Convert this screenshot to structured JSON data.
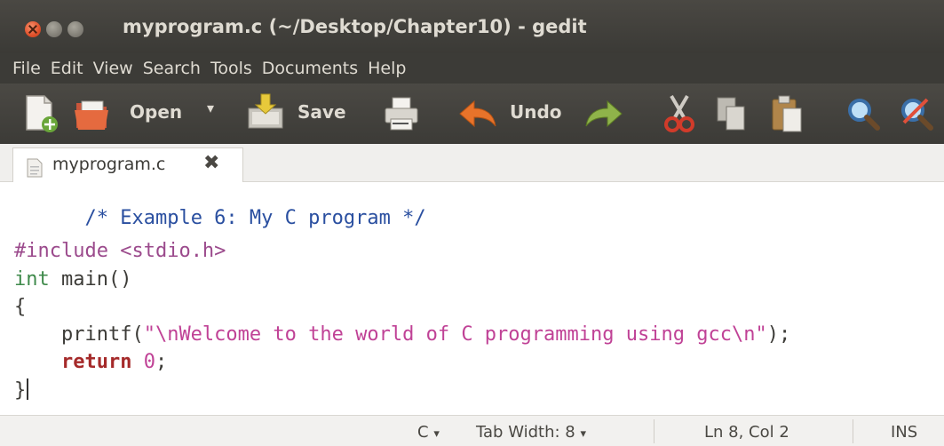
{
  "window": {
    "title": "myprogram.c (~/Desktop/Chapter10) - gedit"
  },
  "menu": [
    "File",
    "Edit",
    "View",
    "Search",
    "Tools",
    "Documents",
    "Help"
  ],
  "toolbar": {
    "open_label": "Open",
    "save_label": "Save",
    "undo_label": "Undo",
    "dropdown_glyph": "▾"
  },
  "tab": {
    "label": "myprogram.c",
    "close_glyph": "✖"
  },
  "code": {
    "line1": "/* Example 6: My C program */",
    "line3_directive": "#include",
    "line3_header": "<stdio.h>",
    "line4_type": "int",
    "line4_rest": " main()",
    "line5": "{",
    "line6_call": "    printf(",
    "line6_string": "\"\\nWelcome to the world of C programming using gcc\\n\"",
    "line6_end": ");",
    "line7_keyword": "return",
    "line7_number": "0",
    "line7_end": ";",
    "line8": "}"
  },
  "status": {
    "language": "C",
    "language_arrow": "▾",
    "tab_width": "Tab Width: 8",
    "tab_width_arrow": "▾",
    "position": "Ln 8, Col 2",
    "mode": "INS"
  },
  "icons": {
    "new": "new-document-icon",
    "open": "open-folder-icon",
    "save": "save-icon",
    "print": "print-icon",
    "undo": "undo-icon",
    "redo": "redo-icon",
    "cut": "cut-icon",
    "copy": "copy-icon",
    "paste": "paste-icon",
    "find": "find-icon",
    "replace": "find-replace-icon"
  }
}
